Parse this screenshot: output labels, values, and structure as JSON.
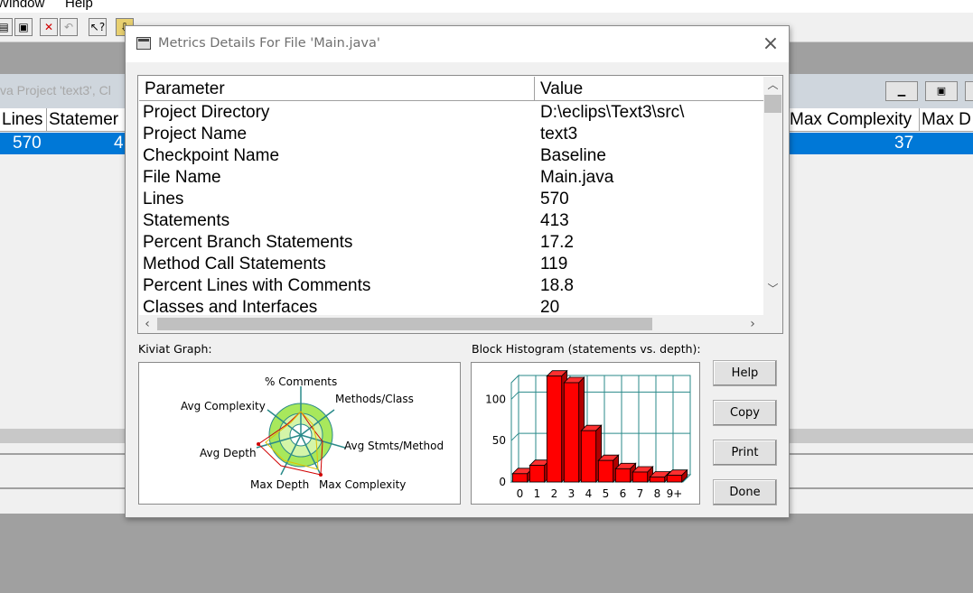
{
  "app": {
    "menu": [
      "Window",
      "Help"
    ],
    "toolbar_icons": [
      "print-icon",
      "print-preview-icon",
      "delete-icon",
      "undo-icon",
      "help-pointer-icon",
      "export-icon"
    ],
    "window_title": "va Project 'text3', Cl",
    "headers": {
      "lines": "Lines",
      "statements": "Statemer",
      "max_complexity": "Max Complexity",
      "max_depth": "Max D"
    },
    "selected_row": {
      "lines": "570",
      "statements": "4",
      "max_complexity": "37"
    }
  },
  "dialog": {
    "title": "Metrics Details For File 'Main.java'",
    "close_glyph": "×",
    "table": {
      "headers": {
        "parameter": "Parameter",
        "value": "Value"
      },
      "rows": [
        {
          "parameter": "Project Directory",
          "value": "D:\\eclips\\Text3\\src\\"
        },
        {
          "parameter": "Project Name",
          "value": "text3"
        },
        {
          "parameter": "Checkpoint Name",
          "value": "Baseline"
        },
        {
          "parameter": "File Name",
          "value": "Main.java"
        },
        {
          "parameter": "Lines",
          "value": "570"
        },
        {
          "parameter": "Statements",
          "value": "413"
        },
        {
          "parameter": "Percent Branch Statements",
          "value": "17.2"
        },
        {
          "parameter": "Method Call Statements",
          "value": "119"
        },
        {
          "parameter": "Percent Lines with Comments",
          "value": "18.8"
        },
        {
          "parameter": "Classes and Interfaces",
          "value": "20"
        }
      ]
    },
    "kiviat": {
      "label": "Kiviat Graph:",
      "axes": [
        "% Comments",
        "Methods/Class",
        "Avg Stmts/Method",
        "Max Complexity",
        "Max Depth",
        "Avg Depth",
        "Avg Complexity"
      ]
    },
    "histogram": {
      "label": "Block Histogram (statements vs. depth):",
      "y_ticks": [
        "0",
        "50",
        "100"
      ],
      "x_ticks": [
        "0",
        "1",
        "2",
        "3",
        "4",
        "5",
        "6",
        "7",
        "8",
        "9+"
      ]
    },
    "buttons": {
      "help": "Help",
      "copy": "Copy",
      "print": "Print",
      "done": "Done"
    }
  },
  "chart_data": {
    "type": "bar",
    "title": "Block Histogram (statements vs. depth):",
    "categories": [
      "0",
      "1",
      "2",
      "3",
      "4",
      "5",
      "6",
      "7",
      "8",
      "9+"
    ],
    "values": [
      10,
      20,
      128,
      120,
      62,
      26,
      16,
      12,
      6,
      8
    ],
    "ylim": [
      0,
      120
    ],
    "bar_color": "#ff0000",
    "grid": true
  }
}
